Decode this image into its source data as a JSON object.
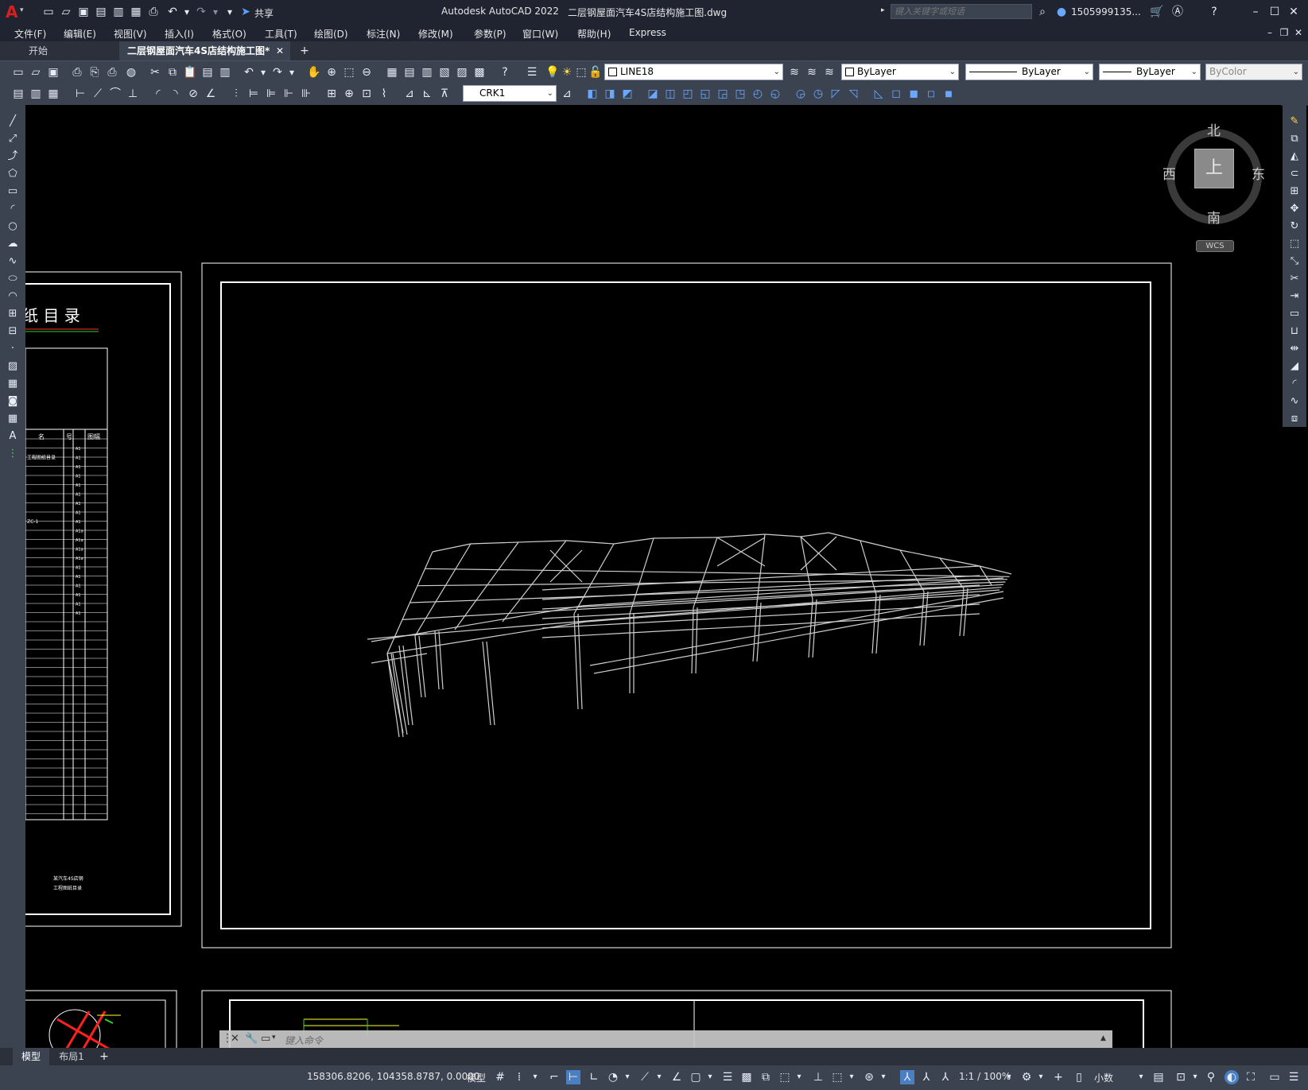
{
  "app": {
    "title": "Autodesk AutoCAD 2022",
    "document": "二层钢屋面汽车4S店结构施工图.dwg",
    "logo": "A",
    "share_label": "共享",
    "search_placeholder": "键入关键字或短语",
    "user": "1505999135...",
    "accent_color": "#d42020"
  },
  "menu": [
    "文件(F)",
    "编辑(E)",
    "视图(V)",
    "插入(I)",
    "格式(O)",
    "工具(T)",
    "绘图(D)",
    "标注(N)",
    "修改(M)",
    "参数(P)",
    "窗口(W)",
    "帮助(H)",
    "Express"
  ],
  "tabs": [
    {
      "label": "开始",
      "active": false
    },
    {
      "label": "二层钢屋面汽车4S店结构施工图*",
      "active": true
    }
  ],
  "toolbar": {
    "layer_name": "LINE18",
    "color": "ByLayer",
    "linetype": "ByLayer",
    "lineweight": "ByLayer",
    "plotstyle": "ByColor",
    "dimstyle": "CRK1"
  },
  "viewcube": {
    "north": "北",
    "south": "南",
    "east": "东",
    "west": "西",
    "face": "上",
    "wcs": "WCS"
  },
  "drawing": {
    "index_title": "纸 目 录",
    "index_header": [
      "名",
      "号",
      "图幅"
    ],
    "index_rows": [
      {
        "name": "",
        "size": "A1"
      },
      {
        "name": "工程图纸目录",
        "size": "A1"
      },
      {
        "name": "",
        "size": "A1"
      },
      {
        "name": "",
        "size": "A1"
      },
      {
        "name": "",
        "size": "A1"
      },
      {
        "name": "",
        "size": "A1"
      },
      {
        "name": "",
        "size": "A1"
      },
      {
        "name": "",
        "size": "A1"
      },
      {
        "name": "ZC-1",
        "size": "A1"
      },
      {
        "name": "",
        "size": "A1a"
      },
      {
        "name": "",
        "size": "A1a"
      },
      {
        "name": "",
        "size": "A1a"
      },
      {
        "name": "",
        "size": "A1a"
      },
      {
        "name": "",
        "size": "A1"
      },
      {
        "name": "",
        "size": "A1"
      },
      {
        "name": "",
        "size": "A1"
      },
      {
        "name": "",
        "size": "A1"
      },
      {
        "name": "",
        "size": "A1"
      },
      {
        "name": "",
        "size": "A1"
      }
    ],
    "index_footer_1": "某汽车4S店钢",
    "index_footer_2": "工程图纸目录"
  },
  "command": {
    "placeholder": "键入命令"
  },
  "layouts": [
    "模型",
    "布局1"
  ],
  "status": {
    "coords": "158306.8206, 104358.8787, 0.0000",
    "space": "模型",
    "scale": "1:1 / 100%",
    "units": "小数"
  }
}
